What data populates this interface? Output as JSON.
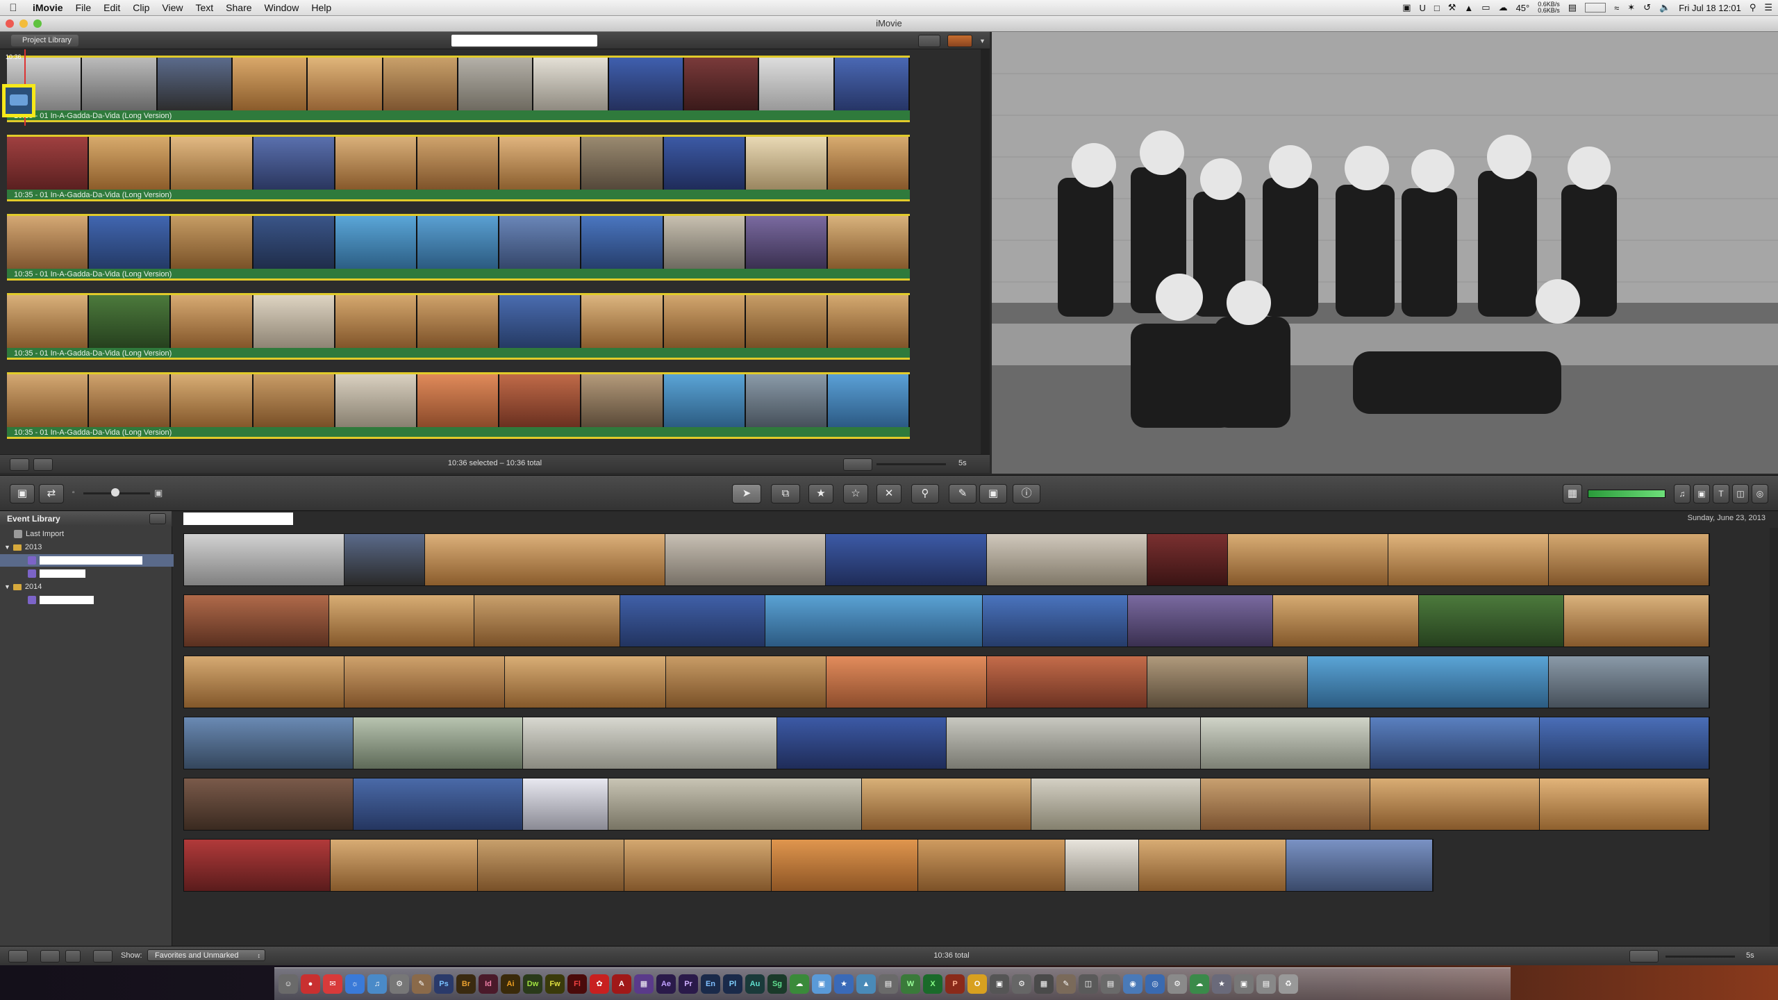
{
  "menubar": {
    "app": "iMovie",
    "items": [
      "File",
      "Edit",
      "Clip",
      "View",
      "Text",
      "Share",
      "Window",
      "Help"
    ],
    "temperature": "45°",
    "net_up": "0.6KB/s",
    "net_down": "0.6KB/s",
    "clock": "Fri Jul 18  12:01"
  },
  "window": {
    "title": "iMovie"
  },
  "project": {
    "library_button": "Project Library",
    "clip_timecode": "10:36",
    "music_label": "10:35 - 01 In-A-Gadda-Da-Vida (Long Version)",
    "status": "10:36 selected – 10:36 total",
    "zoom": "5s"
  },
  "event_library": {
    "title": "Event Library",
    "last_import": "Last Import",
    "years": [
      "2013",
      "2014"
    ],
    "date": "Sunday, June 23, 2013"
  },
  "bottom": {
    "show_label": "Show:",
    "show_value": "Favorites and Unmarked",
    "total": "10:36 total",
    "zoom": "5s"
  },
  "colors": {
    "selection": "#e1cb2a",
    "music": "#2f7a3c",
    "highlight": "#f6e81a"
  }
}
